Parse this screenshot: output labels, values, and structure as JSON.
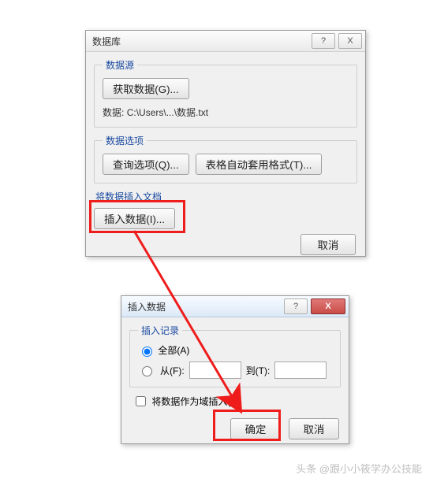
{
  "dialog1": {
    "title": "数据库",
    "help_label": "?",
    "close_label": "X",
    "group_datasource": "数据源",
    "btn_get_data": "获取数据(G)...",
    "path_label": "数据:",
    "path_value": "C:\\Users\\...\\数据.txt",
    "group_dataoptions": "数据选项",
    "btn_query_options": "查询选项(Q)...",
    "btn_autoformat": "表格自动套用格式(T)...",
    "label_insert_into_doc": "将数据插入文档",
    "btn_insert_data": "插入数据(I)...",
    "btn_cancel": "取消"
  },
  "dialog2": {
    "title": "插入数据",
    "help_label": "?",
    "close_label": "X",
    "group_insert_records": "插入记录",
    "radio_all": "全部(A)",
    "radio_from": "从(F):",
    "label_to": "到(T):",
    "from_value": "",
    "to_value": "",
    "checkbox_insert_as_field": "将数据作为域插入(I)",
    "btn_ok": "确定",
    "btn_cancel": "取消"
  },
  "watermark": "头条 @跟小小筱学办公技能"
}
